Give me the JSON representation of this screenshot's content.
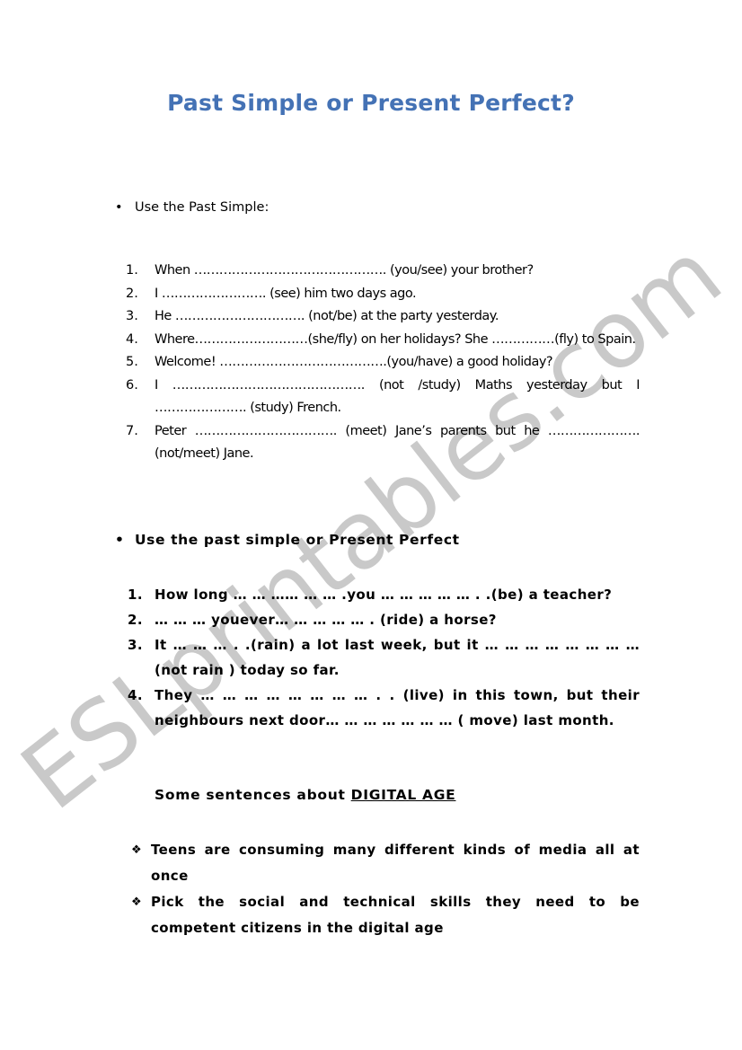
{
  "document": {
    "title": "Past Simple or Present Perfect?",
    "title_color": "#4472b5",
    "watermark": "ESLprintables.com",
    "watermark_color": "#c9c9c9"
  },
  "section1": {
    "bullet": "•",
    "heading": "Use the Past Simple:",
    "items": [
      {
        "num": "1.",
        "text": "When ………………………………………. (you/see) your brother?"
      },
      {
        "num": "2.",
        "text": "I ……………………. (see) him two days ago."
      },
      {
        "num": "3.",
        "text": "He …………………………. (not/be) at the party yesterday."
      },
      {
        "num": "4.",
        "text": "Where………………………(she/fly) on her holidays? She ……………(fly) to Spain."
      },
      {
        "num": "5.",
        "text": "Welcome! ………………………………….(you/have) a good holiday?"
      },
      {
        "num": "6.",
        "text": "I ………………………………………. (not /study) Maths yesterday but I …………………. (study) French."
      },
      {
        "num": "7.",
        "text": "Peter ……………………………. (meet) Jane’s parents but he ………………….(not/meet) Jane."
      }
    ]
  },
  "section2": {
    "bullet": "•",
    "heading": "Use the past simple or Present Perfect",
    "items": [
      {
        "num": "1.",
        "text": "How long … … …… … … .you … … … … … . .(be) a teacher?"
      },
      {
        "num": "2.",
        "text": "… … …  youever… … … … … . (ride) a horse?"
      },
      {
        "num": "3.",
        "text": "It … … … . .(rain) a lot last week, but it … … … … … … … … (not rain ) today so far."
      },
      {
        "num": "4.",
        "text": "They … … … … … … … … . . (live) in this town, but their neighbours next door… … … … … … … ( move) last month."
      }
    ]
  },
  "section3": {
    "subheading_prefix": "Some sentences about ",
    "subheading_underlined": "DIGITAL AGE",
    "bullet": "❖",
    "items": [
      {
        "text": "Teens are consuming many different kinds of media all at once"
      },
      {
        "text": "Pick the social and technical skills they need to be competent citizens in the digital age"
      }
    ]
  }
}
